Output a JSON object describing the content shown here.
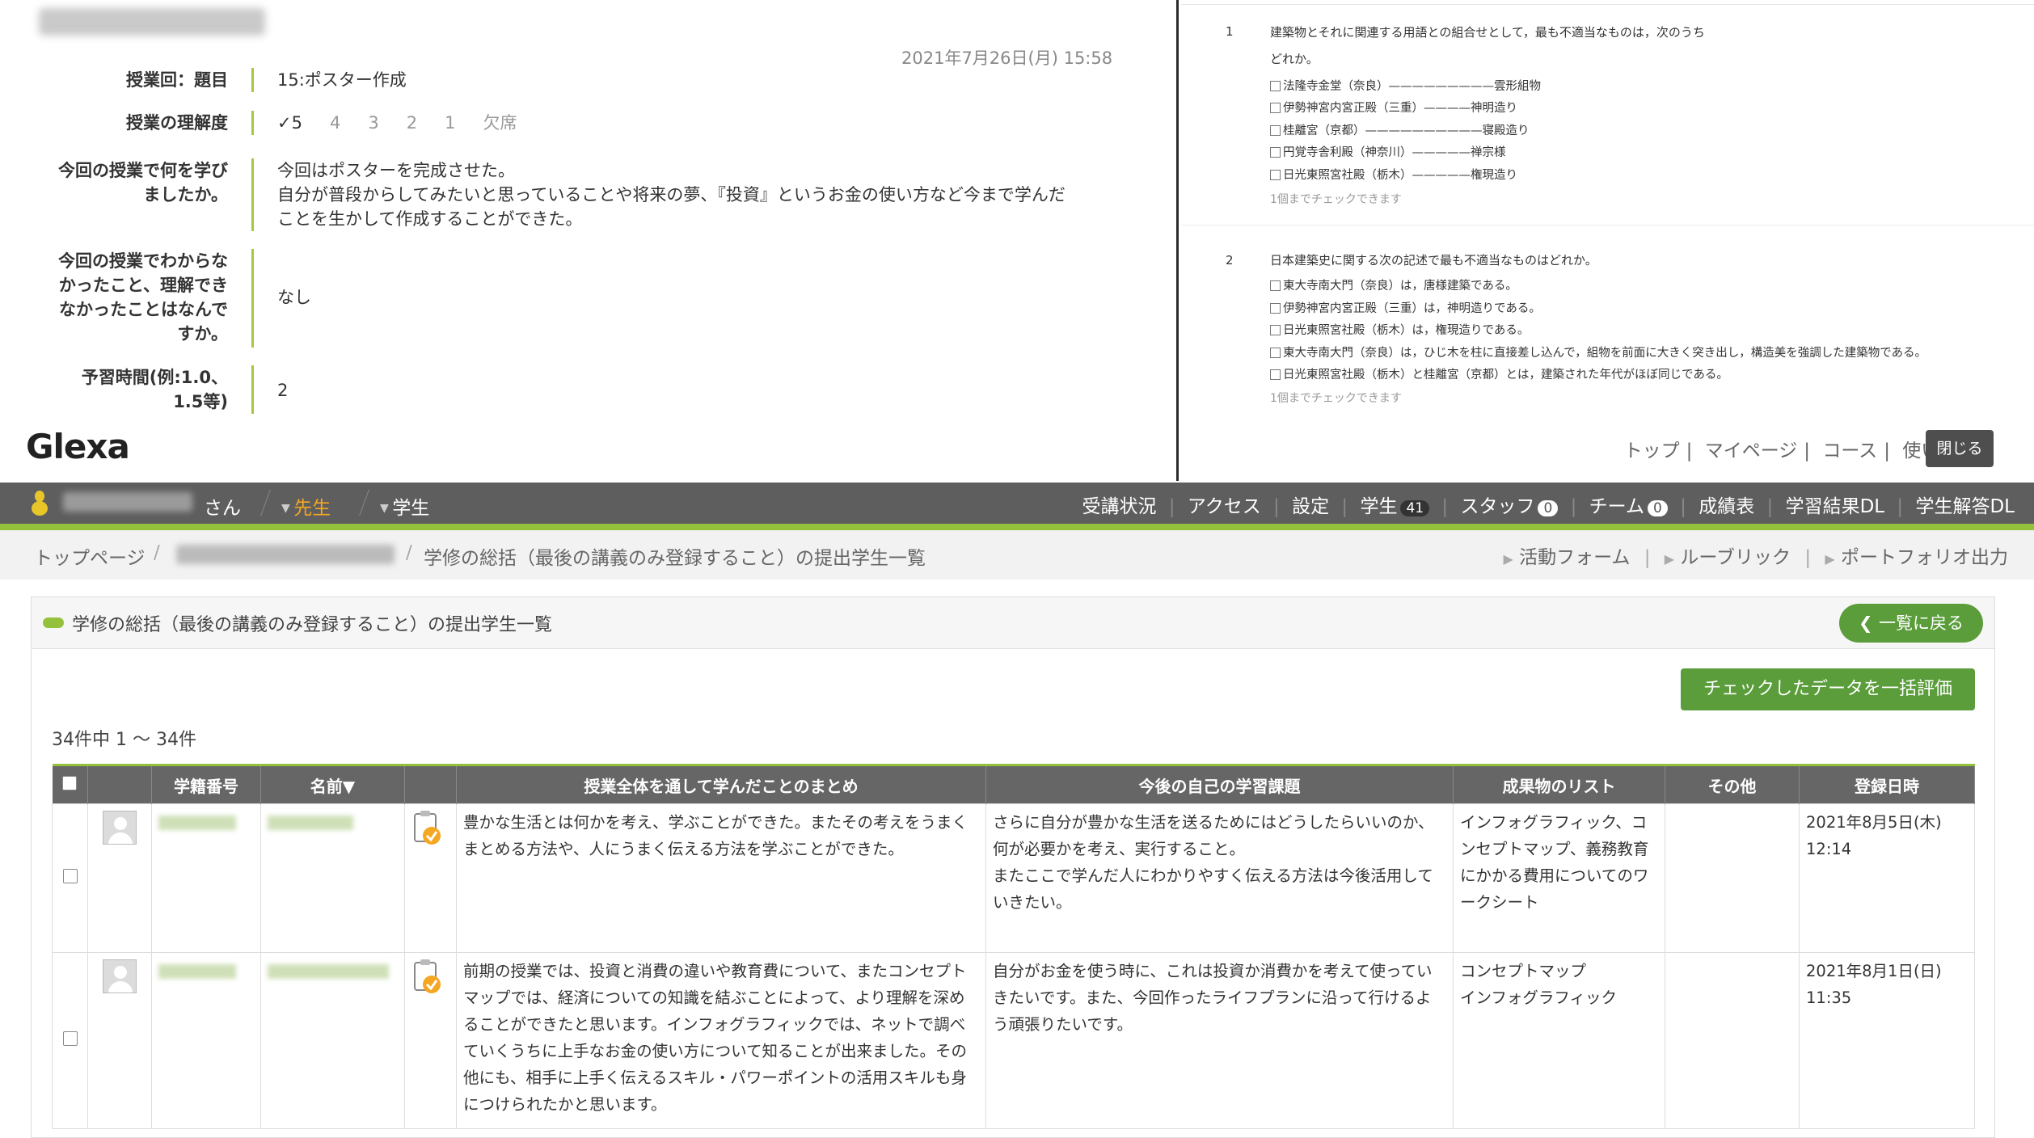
{
  "report": {
    "date": "2021年7月26日(月) 15:58",
    "fields": [
      {
        "label": "授業回：題目",
        "value": "15:ポスター作成"
      },
      {
        "label": "授業の理解度",
        "value": ""
      },
      {
        "label": "今回の授業で何を学びましたか。",
        "value": "今回はポスターを完成させた。\n自分が普段からしてみたいと思っていることや将来の夢、『投資』というお金の使い方など今まで学んだことを生かして作成することができた。"
      },
      {
        "label": "今回の授業でわからなかったこと、理解できなかったことはなんですか。",
        "value": "なし"
      },
      {
        "label": "予習時間(例:1.0、1.5等)",
        "value": "2"
      }
    ],
    "rating_options": [
      "✓5",
      "4",
      "3",
      "2",
      "1",
      "欠席"
    ],
    "rating_selected": "5"
  },
  "logo": "Glexa",
  "quiz": {
    "questions": [
      {
        "num": "1",
        "text_line1": "建築物とそれに関連する用語との組合せとして，最も不適当なものは，次のうち",
        "text_line2": "どれか。",
        "options": [
          "法隆寺金堂（奈良）—————————雲形組物",
          "伊勢神宮内宮正殿（三重）————神明造り",
          "桂離宮（京都）——————————寝殿造り",
          "円覚寺舎利殿（神奈川）—————禅宗様",
          "日光東照宮社殿（栃木）—————権現造り"
        ],
        "note": "1個までチェックできます"
      },
      {
        "num": "2",
        "text_line1": "日本建築史に関する次の記述で最も不適当なものはどれか。",
        "options": [
          "東大寺南大門（奈良）は，唐様建築である。",
          "伊勢神宮内宮正殿（三重）は，神明造りである。",
          "日光東照宮社殿（栃木）は，権現造りである。",
          "東大寺南大門（奈良）は，ひじ木を柱に直接差し込んで，組物を前面に大きく突き出し，構造美を強調した建築物である。",
          "日光東照宮社殿（栃木）と桂離宮（京都）とは，建築された年代がほぼ同じである。"
        ],
        "note": "1個までチェックできます"
      }
    ]
  },
  "top_nav": [
    "トップ",
    "マイページ",
    "コース",
    "使い方"
  ],
  "close_label": "閉じる",
  "user_bar": {
    "user_suffix": "さん",
    "role_teacher": "先生",
    "role_student": "学生",
    "menu": [
      {
        "label": "受講状況"
      },
      {
        "label": "アクセス"
      },
      {
        "label": "設定"
      },
      {
        "label": "学生",
        "badge": "41"
      },
      {
        "label": "スタッフ",
        "badge": "0"
      },
      {
        "label": "チーム",
        "badge": "0"
      },
      {
        "label": "成績表"
      },
      {
        "label": "学習結果DL"
      },
      {
        "label": "学生解答DL"
      }
    ]
  },
  "breadcrumb": {
    "home": "トップページ",
    "current": "学修の総括（最後の講義のみ登録すること）の提出学生一覧",
    "actions": [
      "活動フォーム",
      "ルーブリック",
      "ポートフォリオ出力"
    ]
  },
  "panel": {
    "title": "学修の総括（最後の講義のみ登録すること）の提出学生一覧",
    "back_label": "一覧に戻る",
    "bulk_label": "チェックしたデータを一括評価",
    "count": "34件中 1 ～ 34件"
  },
  "table": {
    "headers": [
      "学籍番号",
      "名前▼",
      "授業全体を通して学んだことのまとめ",
      "今後の自己の学習課題",
      "成果物のリスト",
      "その他",
      "登録日時"
    ],
    "rows": [
      {
        "summary": "豊かな生活とは何かを考え、学ぶことができた。またその考えをうまくまとめる方法や、人にうまく伝える方法を学ぶことができた。",
        "task": "さらに自分が豊かな生活を送るためにはどうしたらいいのか、何が必要かを考え、実行すること。\nまたここで学んだ人にわかりやすく伝える方法は今後活用していきたい。",
        "artifacts": "インフォグラフィック、コンセプトマップ、義務教育にかかる費用についてのワークシート",
        "other": "",
        "date": "2021年8月5日(木)\n12:14"
      },
      {
        "summary": "前期の授業では、投資と消費の違いや教育費について、またコンセプトマップでは、経済についての知識を結ぶことによって、より理解を深めることができたと思います。インフォグラフィックでは、ネットで調べていくうちに上手なお金の使い方について知ることが出来ました。その他にも、相手に上手く伝えるスキル・パワーポイントの活用スキルも身につけられたかと思います。",
        "task": "自分がお金を使う時に、これは投資か消費かを考えて使っていきたいです。また、今回作ったライフプランに沿って行けるよう頑張りたいです。",
        "artifacts": "コンセプトマップ\nインフォグラフィック",
        "other": "",
        "date": "2021年8月1日(日)\n11:35"
      }
    ]
  },
  "colors": {
    "accent_green": "#94c13c",
    "button_green": "#5a9d3a",
    "teacher_orange": "#f5a623",
    "dark_bar": "#5e5e5e"
  }
}
